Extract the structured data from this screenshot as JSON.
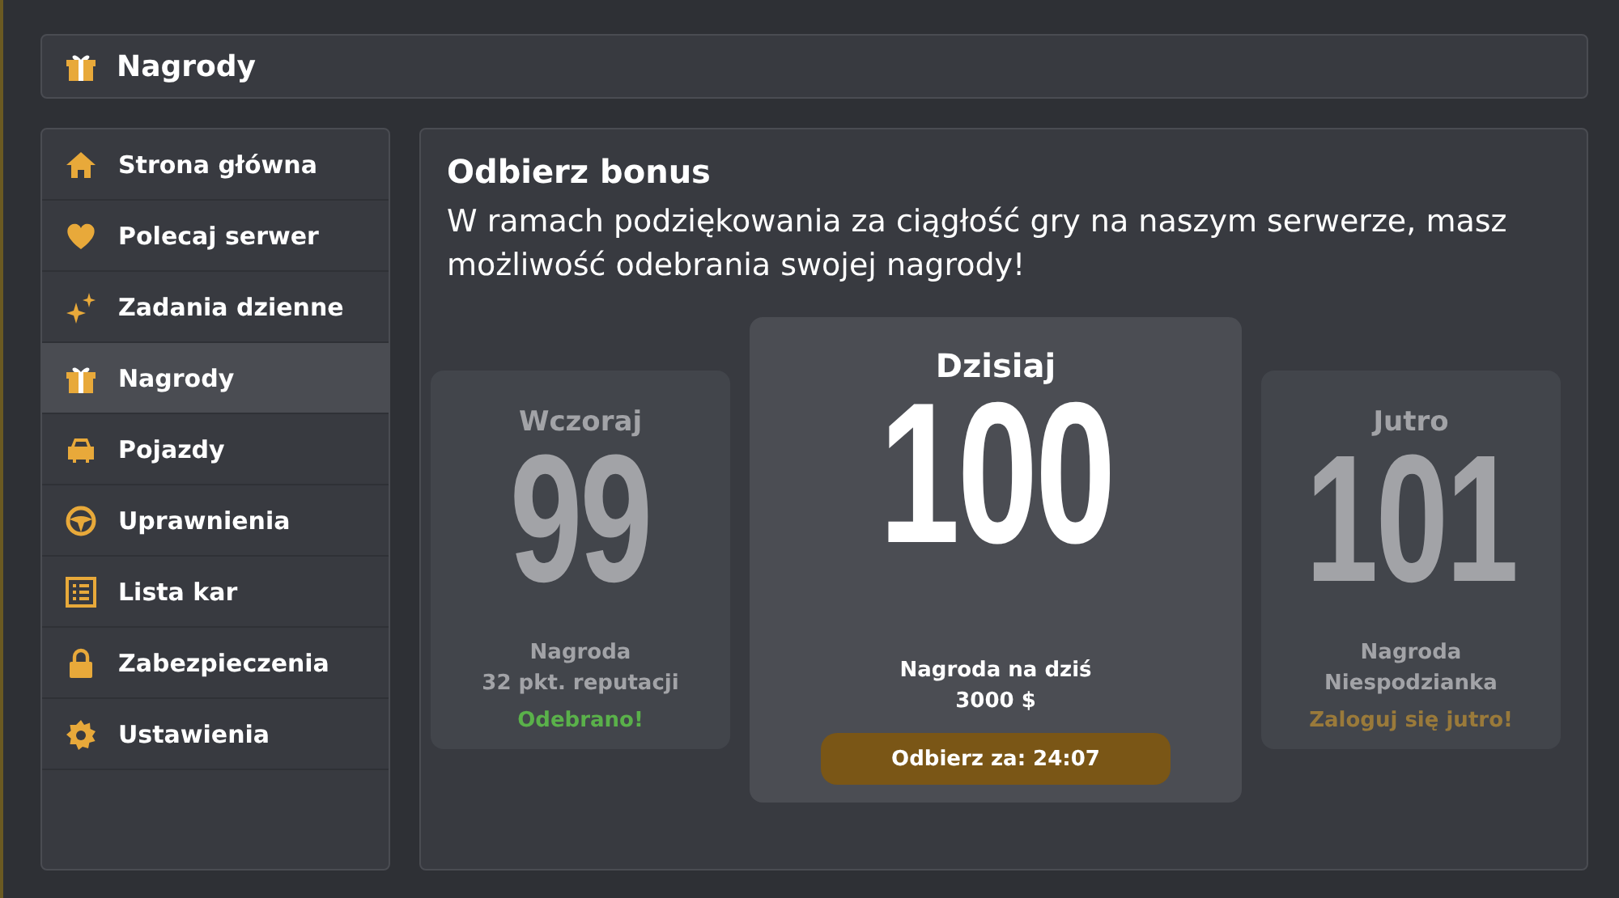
{
  "header": {
    "title": "Nagrody"
  },
  "sidebar": {
    "items": [
      {
        "label": "Strona główna",
        "selected": false
      },
      {
        "label": "Polecaj serwer",
        "selected": false
      },
      {
        "label": "Zadania dzienne",
        "selected": false
      },
      {
        "label": "Nagrody",
        "selected": true
      },
      {
        "label": "Pojazdy",
        "selected": false
      },
      {
        "label": "Uprawnienia",
        "selected": false
      },
      {
        "label": "Lista kar",
        "selected": false
      },
      {
        "label": "Zabezpieczenia",
        "selected": false
      },
      {
        "label": "Ustawienia",
        "selected": false
      }
    ]
  },
  "content": {
    "title": "Odbierz bonus",
    "description": "W ramach podziękowania za ciągłość gry na naszym serwerze, masz możliwość odebrania swojej nagrody!",
    "cards": [
      {
        "kind": "past",
        "label": "Wczoraj",
        "number": "99",
        "lines": [
          "Nagroda",
          "32 pkt. reputacji"
        ],
        "status": "Odebrano!"
      },
      {
        "kind": "current",
        "label": "Dzisiaj",
        "number": "100",
        "lines": [
          "Nagroda na dziś",
          "3000 $"
        ],
        "button": "Odbierz za: 24:07"
      },
      {
        "kind": "future",
        "label": "Jutro",
        "number": "101",
        "lines": [
          "Nagroda",
          "Niespodzianka"
        ],
        "status": "Zaloguj się jutro!"
      }
    ]
  }
}
